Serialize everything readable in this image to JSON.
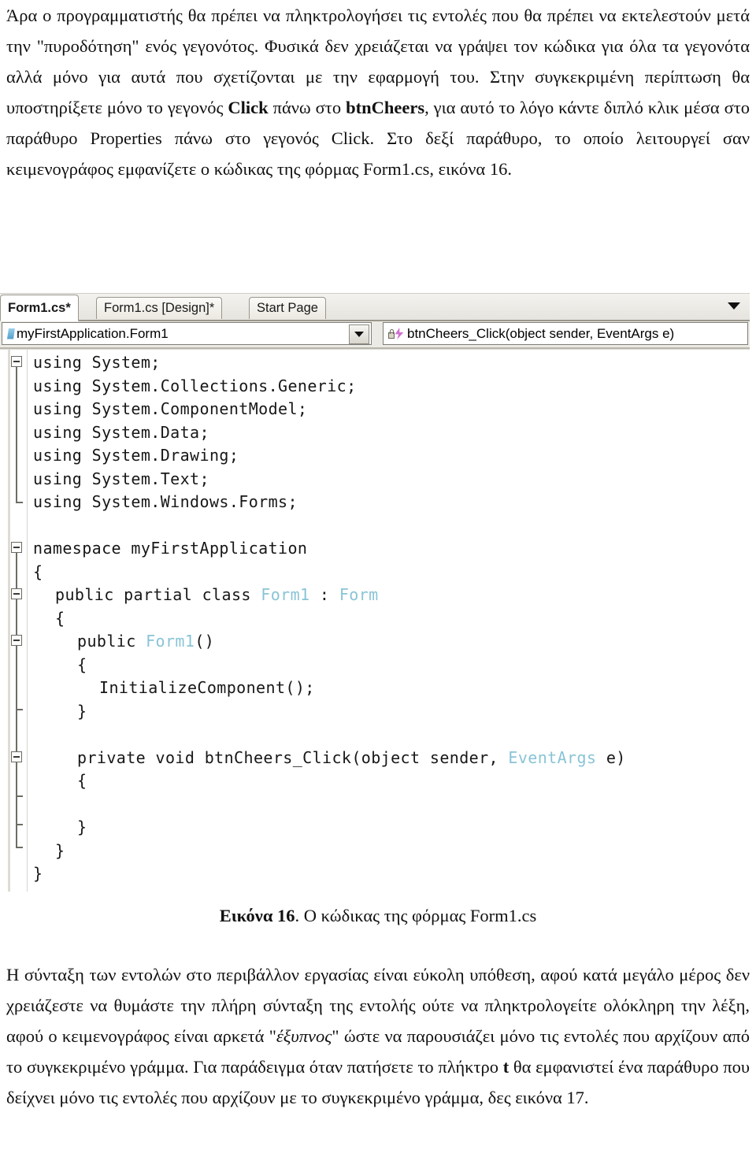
{
  "document": {
    "paragraph_top": "Άρα ο προγραμματιστής θα πρέπει να πληκτρολογήσει τις εντολές που θα πρέπει να εκτελεστούν μετά την \"πυροδότηση\" ενός γεγονότος. Φυσικά δεν χρειάζεται να γράψει τον κώδικα για όλα τα γεγονότα αλλά μόνο για αυτά που σχετίζονται με την εφαρμογή του. Στην συγκεκριμένη περίπτωση θα υποστηρίξετε μόνο το γεγονός ",
    "para_top_b1": "Click",
    "para_top_mid1": " πάνω στο ",
    "para_top_b2": "btnCheers",
    "para_top_mid2": ", για αυτό το λόγο κάντε διπλό κλικ μέσα στο παράθυρο Properties πάνω στο γεγονός Click. Στο δεξί παράθυρο, το οποίο λειτουργεί σαν κειμενογράφος εμφανίζετε ο κώδικας της φόρμας Form1.cs, εικόνα 16.",
    "figure_caption_label": "Εικόνα 16",
    "figure_caption_text": ". Ο κώδικας της φόρμας Form1.cs",
    "para_bottom_1": "Η σύνταξη των εντολών στο περιβάλλον εργασίας είναι εύκολη υπόθεση, αφού κατά μεγάλο μέρος δεν χρειάζεστε να θυμάστε την πλήρη σύνταξη της εντολής ούτε να πληκτρολογείτε ολόκληρη την λέξη, αφού ο κειμενογράφος είναι αρκετά \"",
    "para_bottom_em": "έξυπνος",
    "para_bottom_2": "\" ώστε να παρουσιάζει μόνο τις εντολές που αρχίζουν από το συγκεκριμένο γράμμα. Για παράδειγμα όταν πατήσετε το πλήκτρο ",
    "para_bottom_b": "t",
    "para_bottom_3": " θα εμφανιστεί ένα παράθυρο που δείχνει μόνο τις εντολές που αρχίζουν με το συγκεκριμένο γράμμα, δες εικόνα 17."
  },
  "vs": {
    "tabs": [
      {
        "label": "Form1.cs*",
        "active": true
      },
      {
        "label": "Form1.cs [Design]*",
        "active": false
      },
      {
        "label": "Start Page",
        "active": false
      }
    ],
    "tab_overflow_icon": "chevron-down-icon",
    "navbar": {
      "left_combo_value": "myFirstApplication.Form1",
      "left_combo_icon": "namespace-icon",
      "right_combo_value": "btnCheers_Click(object sender, EventArgs e)",
      "right_combo_icon": "event-lightning-icon",
      "dropdown_icon": "chevron-down-icon"
    },
    "colors": {
      "type_blue": "#89c4d6",
      "code_text": "#171717",
      "editor_background": "#ffffff",
      "chrome_background": "#eceae4"
    },
    "code_lines": [
      {
        "text": "using System;",
        "indent": 0
      },
      {
        "text": "using System.Collections.Generic;",
        "indent": 0
      },
      {
        "text": "using System.ComponentModel;",
        "indent": 0
      },
      {
        "text": "using System.Data;",
        "indent": 0
      },
      {
        "text": "using System.Drawing;",
        "indent": 0
      },
      {
        "text": "using System.Text;",
        "indent": 0
      },
      {
        "text": "using System.Windows.Forms;",
        "indent": 0
      },
      {
        "text": "",
        "indent": 0
      },
      {
        "text": "namespace myFirstApplication",
        "indent": 0
      },
      {
        "text": "{",
        "indent": 0
      },
      {
        "text": "public partial class Form1 : Form",
        "indent": 1
      },
      {
        "text": "{",
        "indent": 1
      },
      {
        "text": "public Form1()",
        "indent": 2
      },
      {
        "text": "{",
        "indent": 2
      },
      {
        "text": "InitializeComponent();",
        "indent": 3
      },
      {
        "text": "}",
        "indent": 2
      },
      {
        "text": "",
        "indent": 0
      },
      {
        "text": "private void btnCheers_Click(object sender, EventArgs e)",
        "indent": 2
      },
      {
        "text": "{",
        "indent": 2
      },
      {
        "text": "",
        "indent": 0
      },
      {
        "text": "}",
        "indent": 2
      },
      {
        "text": "}",
        "indent": 1
      },
      {
        "text": "}",
        "indent": 0
      }
    ]
  }
}
